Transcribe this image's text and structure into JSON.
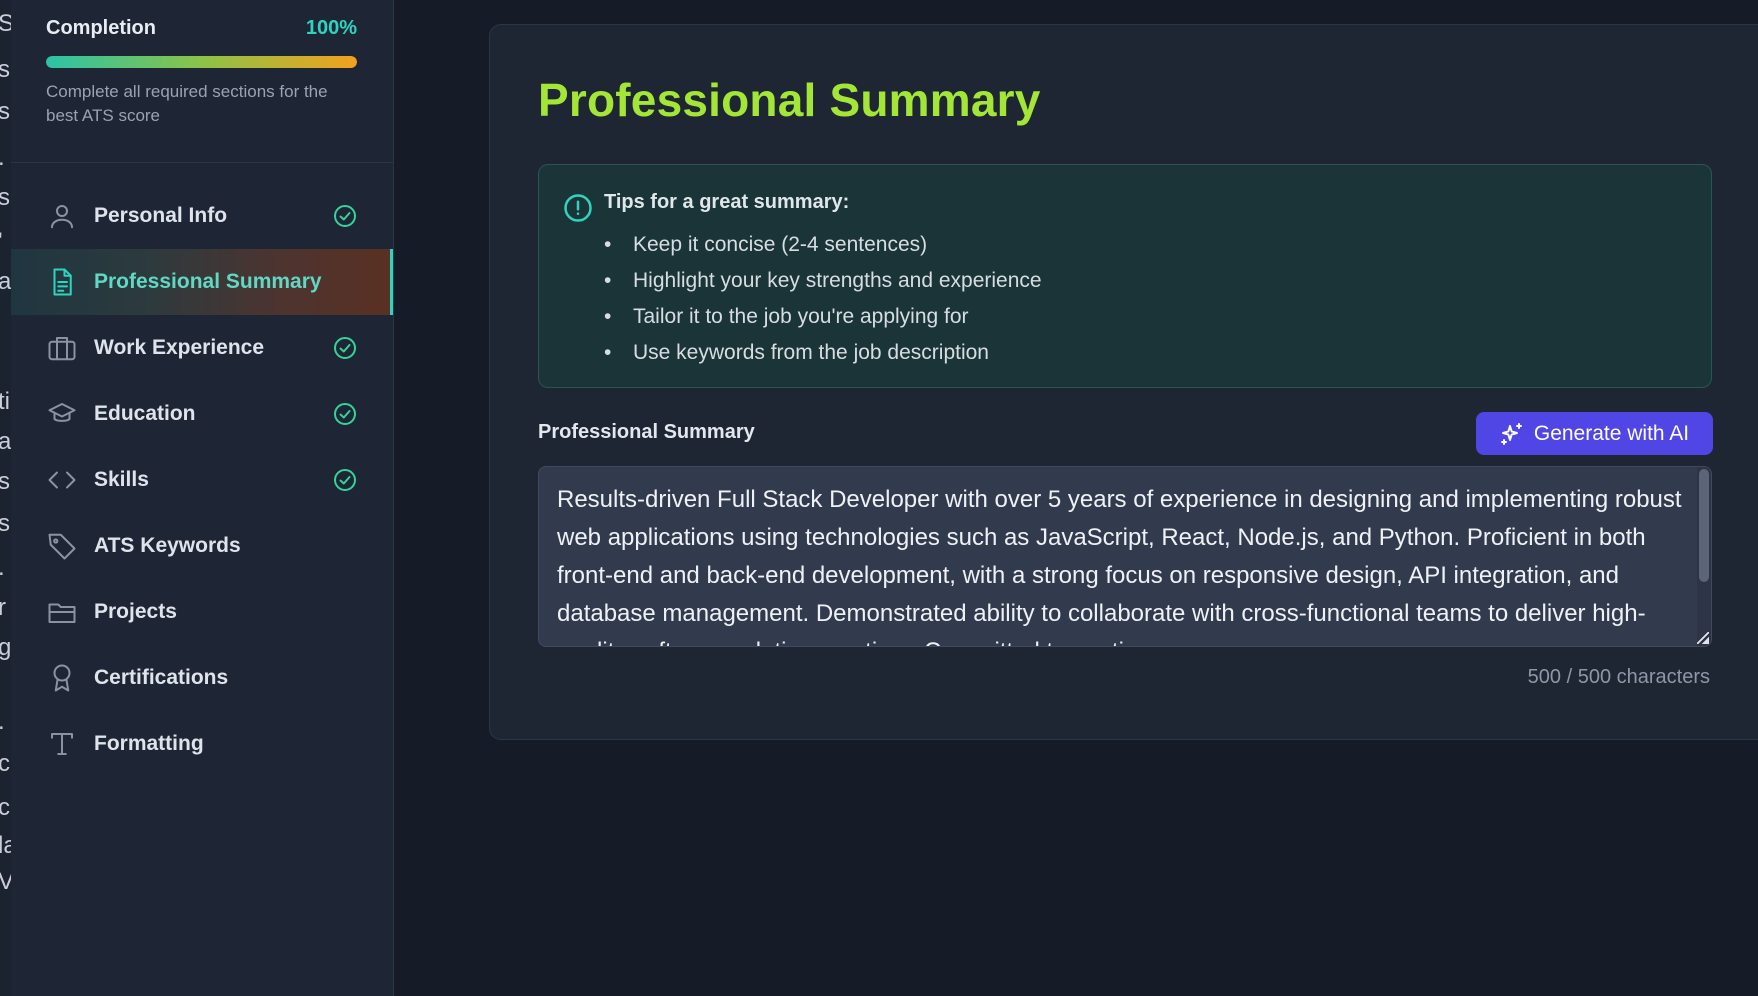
{
  "left_strip_glyphs": [
    "S",
    "s",
    "s",
    ".",
    "s",
    "'",
    "a",
    "ti",
    "a",
    "s",
    "s",
    ".",
    "r",
    "g",
    "",
    ".",
    "c",
    "c",
    "la",
    "V"
  ],
  "sidebar": {
    "completion_label": "Completion",
    "completion_value": "100%",
    "completion_fraction": 1.0,
    "completion_hint": "Complete all required sections for the best ATS score",
    "items": [
      {
        "label": "Personal Info",
        "icon": "user-icon",
        "complete": true,
        "active": false
      },
      {
        "label": "Professional Summary",
        "icon": "document-icon",
        "complete": false,
        "active": true
      },
      {
        "label": "Work Experience",
        "icon": "briefcase-icon",
        "complete": true,
        "active": false
      },
      {
        "label": "Education",
        "icon": "graduation-cap-icon",
        "complete": true,
        "active": false
      },
      {
        "label": "Skills",
        "icon": "code-icon",
        "complete": true,
        "active": false
      },
      {
        "label": "ATS Keywords",
        "icon": "tag-icon",
        "complete": false,
        "active": false
      },
      {
        "label": "Projects",
        "icon": "folder-icon",
        "complete": false,
        "active": false
      },
      {
        "label": "Certifications",
        "icon": "award-icon",
        "complete": false,
        "active": false
      },
      {
        "label": "Formatting",
        "icon": "type-icon",
        "complete": false,
        "active": false
      }
    ]
  },
  "main": {
    "title": "Professional Summary",
    "tips": {
      "title": "Tips for a great summary:",
      "items": [
        "Keep it concise (2-4 sentences)",
        "Highlight your key strengths and experience",
        "Tailor it to the job you're applying for",
        "Use keywords from the job description"
      ]
    },
    "field_label": "Professional Summary",
    "ai_button_label": "Generate with AI",
    "summary_text": "Results-driven Full Stack Developer with over 5 years of experience in designing and implementing robust web applications using technologies such as JavaScript, React, Node.js, and Python. Proficient in both front-end and back-end development, with a strong focus on responsive design, API integration, and database management. Demonstrated ability to collaborate with cross-functional teams to deliver high-quality software solutions on time. Committed to continuous",
    "char_count": "500 / 500 characters"
  },
  "colors": {
    "accent_teal": "#2dd4bf",
    "title_green": "#a3e635",
    "ai_button": "#4f46e5",
    "check_green": "#34d399"
  }
}
